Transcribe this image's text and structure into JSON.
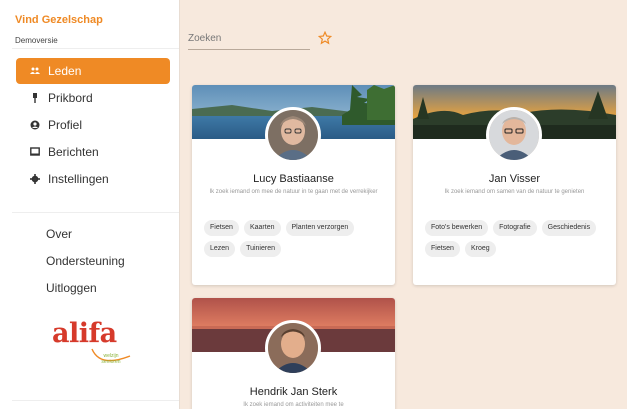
{
  "app": {
    "title": "Vind Gezelschap",
    "subtitle": "Demoversie"
  },
  "colors": {
    "accent": "#ef8a25",
    "background": "#f7e9dd",
    "logo_red": "#d63a2b",
    "logo_green": "#8bb33a"
  },
  "sidebar": {
    "items": [
      {
        "label": "Leden",
        "icon": "group-icon",
        "active": true
      },
      {
        "label": "Prikbord",
        "icon": "pin-icon",
        "active": false
      },
      {
        "label": "Profiel",
        "icon": "profile-icon",
        "active": false
      },
      {
        "label": "Berichten",
        "icon": "message-icon",
        "active": false
      },
      {
        "label": "Instellingen",
        "icon": "gear-icon",
        "active": false
      }
    ],
    "links": [
      {
        "label": "Over"
      },
      {
        "label": "Ondersteuning"
      },
      {
        "label": "Uitloggen"
      }
    ],
    "logo": {
      "text": "alifa",
      "tagline": "welzijn senioren"
    }
  },
  "search": {
    "placeholder": "Zoeken",
    "value": "",
    "favorite_icon": "star-icon"
  },
  "members": [
    {
      "name": "Lucy Bastiaanse",
      "description": "Ik zoek iemand om mee de natuur in te gaan met de verrekijker",
      "tags": [
        "Fietsen",
        "Kaarten",
        "Planten verzorgen",
        "Lezen",
        "Tuinieren"
      ]
    },
    {
      "name": "Jan Visser",
      "description": "Ik zoek iemand om samen van de natuur te genieten",
      "tags": [
        "Foto's bewerken",
        "Fotografie",
        "Geschiedenis",
        "Fietsen",
        "Kroeg"
      ]
    },
    {
      "name": "Hendrik Jan Sterk",
      "description": "Ik zoek iemand om activiteiten mee te",
      "tags": []
    }
  ]
}
